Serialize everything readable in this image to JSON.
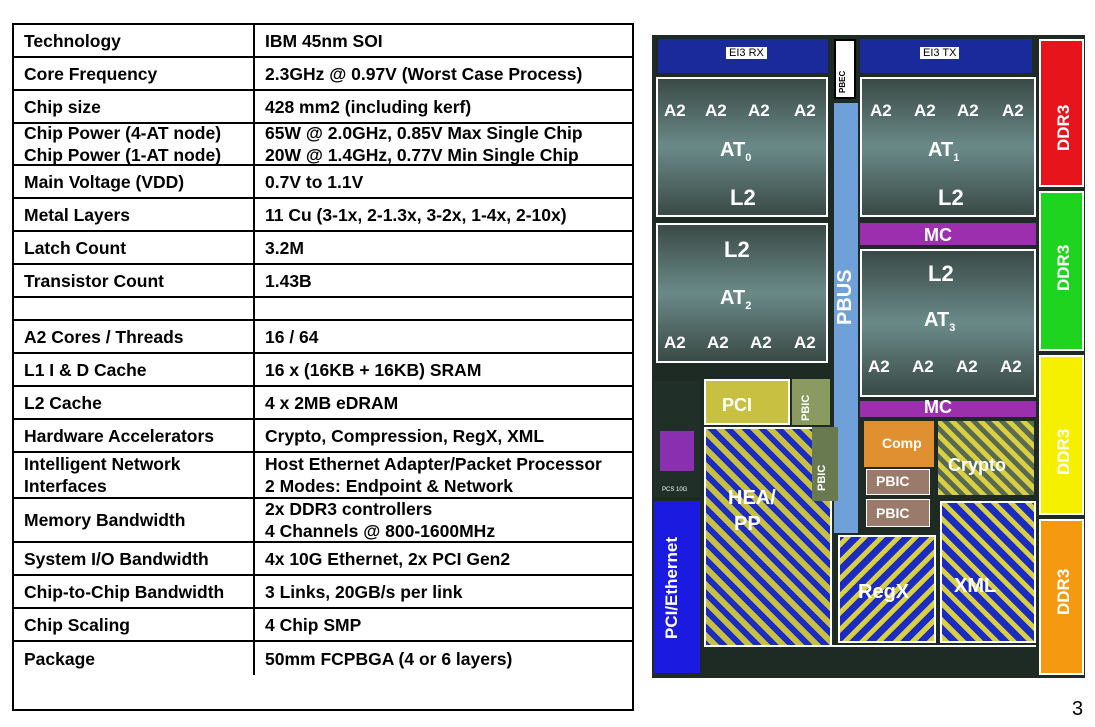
{
  "spec_table": [
    {
      "label": [
        "Technology"
      ],
      "value": [
        "IBM 45nm SOI"
      ]
    },
    {
      "label": [
        "Core Frequency"
      ],
      "value": [
        "2.3GHz @ 0.97V (Worst Case Process)"
      ]
    },
    {
      "label": [
        "Chip size"
      ],
      "value": [
        "428 mm2 (including kerf)"
      ]
    },
    {
      "label": [
        "Chip Power (4-AT node)",
        "Chip Power (1-AT node)"
      ],
      "value": [
        "65W @ 2.0GHz, 0.85V  Max Single Chip",
        "20W @ 1.4GHz, 0.77V  Min Single Chip"
      ]
    },
    {
      "label": [
        "Main Voltage (VDD)"
      ],
      "value": [
        "0.7V to 1.1V"
      ]
    },
    {
      "label": [
        "Metal Layers"
      ],
      "value": [
        "11 Cu (3-1x, 2-1.3x, 3-2x, 1-4x, 2-10x)"
      ]
    },
    {
      "label": [
        "Latch Count"
      ],
      "value": [
        "3.2M"
      ]
    },
    {
      "label": [
        "Transistor Count"
      ],
      "value": [
        "1.43B"
      ]
    },
    {
      "label": [
        ""
      ],
      "value": [
        ""
      ]
    },
    {
      "label": [
        "A2 Cores / Threads"
      ],
      "value": [
        "16 / 64"
      ]
    },
    {
      "label": [
        "L1 I & D Cache"
      ],
      "value": [
        "16 x (16KB + 16KB) SRAM"
      ]
    },
    {
      "label": [
        "L2 Cache"
      ],
      "value": [
        "4 x 2MB eDRAM"
      ]
    },
    {
      "label": [
        "Hardware Accelerators"
      ],
      "value": [
        "Crypto, Compression, RegX, XML"
      ]
    },
    {
      "label": [
        "Intelligent Network",
        "Interfaces"
      ],
      "value": [
        "Host Ethernet Adapter/Packet Processor",
        "2 Modes: Endpoint & Network"
      ]
    },
    {
      "label": [
        "Memory Bandwidth"
      ],
      "value": [
        "2x DDR3 controllers",
        "4 Channels @ 800-1600MHz"
      ]
    },
    {
      "label": [
        "System I/O Bandwidth"
      ],
      "value": [
        "4x 10G Ethernet, 2x PCI Gen2"
      ]
    },
    {
      "label": [
        "Chip-to-Chip Bandwidth"
      ],
      "value": [
        "3 Links, 20GB/s per link"
      ]
    },
    {
      "label": [
        "Chip Scaling"
      ],
      "value": [
        "4 Chip SMP"
      ]
    },
    {
      "label": [
        "Package"
      ],
      "value": [
        "50mm FCPBGA (4 or 6 layers)"
      ]
    }
  ],
  "die": {
    "ei3_rx": "EI3 RX",
    "ei3_tx": "EI3 TX",
    "pbec": "PBEC",
    "a2": "A2",
    "at": "AT",
    "at_subs": [
      "0",
      "1",
      "2",
      "3"
    ],
    "l2": "L2",
    "mc": "MC",
    "pbus": "PBUS",
    "pci": "PCI",
    "pbic": "PBIC",
    "comp": "Comp",
    "crypto": "Crypto",
    "hea_pp": [
      "HEA/",
      "PP"
    ],
    "regx": "RegX",
    "xml": "XML",
    "pci_ethernet": "PCI/Ethernet",
    "ddr3": "DDR3",
    "pcs": "PCS 10G",
    "colors": {
      "ddr3_red": "#e8141c",
      "ddr3_green": "#1fd41f",
      "ddr3_yellow": "#f5f000",
      "ddr3_orange": "#f59a10",
      "mc_purple": "#9b2fae",
      "pbus_blue": "#6fa0d8",
      "accel_blue": "#1d2cc0",
      "accel_yellow": "#d8d040"
    }
  },
  "page_number": "3"
}
